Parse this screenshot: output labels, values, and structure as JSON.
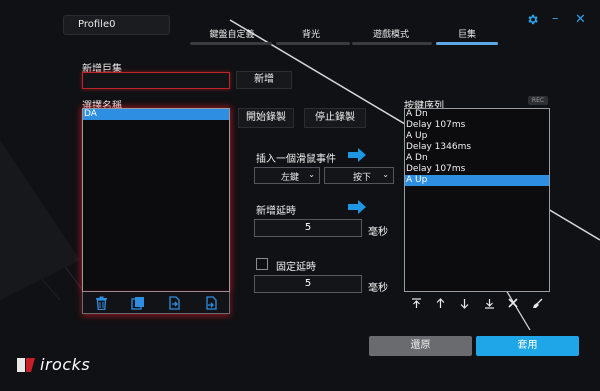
{
  "header": {
    "profile": "Profile0",
    "tabs": [
      {
        "label": "鍵盤自定義"
      },
      {
        "label": "背光"
      },
      {
        "label": "遊戲模式"
      },
      {
        "label": "巨集",
        "active": true
      }
    ],
    "window": {
      "settings_icon": "gear-icon",
      "minimize": "–",
      "close": "✕"
    }
  },
  "new_macro": {
    "label": "新增巨集",
    "value": "",
    "add_button": "新增"
  },
  "macro_list": {
    "label": "選擇名稱",
    "items": [
      "DA"
    ],
    "selected_index": 0,
    "toolbar_icons": [
      "trash-icon",
      "copy-icon",
      "import-icon",
      "export-icon"
    ]
  },
  "record": {
    "start": "開始錄製",
    "stop": "停止錄製"
  },
  "mouse_event": {
    "label": "插入一個滑鼠事件",
    "button_value": "左鍵",
    "action_value": "按下"
  },
  "delay": {
    "label": "新增延時",
    "value": "5",
    "unit": "毫秒"
  },
  "fixed_delay": {
    "label": "固定延時",
    "checked": false,
    "value": "5",
    "unit": "毫秒"
  },
  "sequence": {
    "label": "按鍵序列",
    "badge": "REC",
    "items": [
      "A Dn",
      "Delay 107ms",
      "A Up",
      "Delay 1346ms",
      "A Dn",
      "Delay 107ms",
      "A Up"
    ],
    "selected_index": 6,
    "toolbar_icons": [
      "move-top-icon",
      "move-up-icon",
      "move-down-icon",
      "move-bottom-icon",
      "delete-icon",
      "clear-icon"
    ]
  },
  "footer": {
    "restore": "還原",
    "apply": "套用",
    "brand": "irocks"
  },
  "colors": {
    "accent": "#2e8ee2",
    "apply_button": "#1fa6e8",
    "restore_button": "#6a6b6e",
    "glow_red": "#dc1e28"
  }
}
